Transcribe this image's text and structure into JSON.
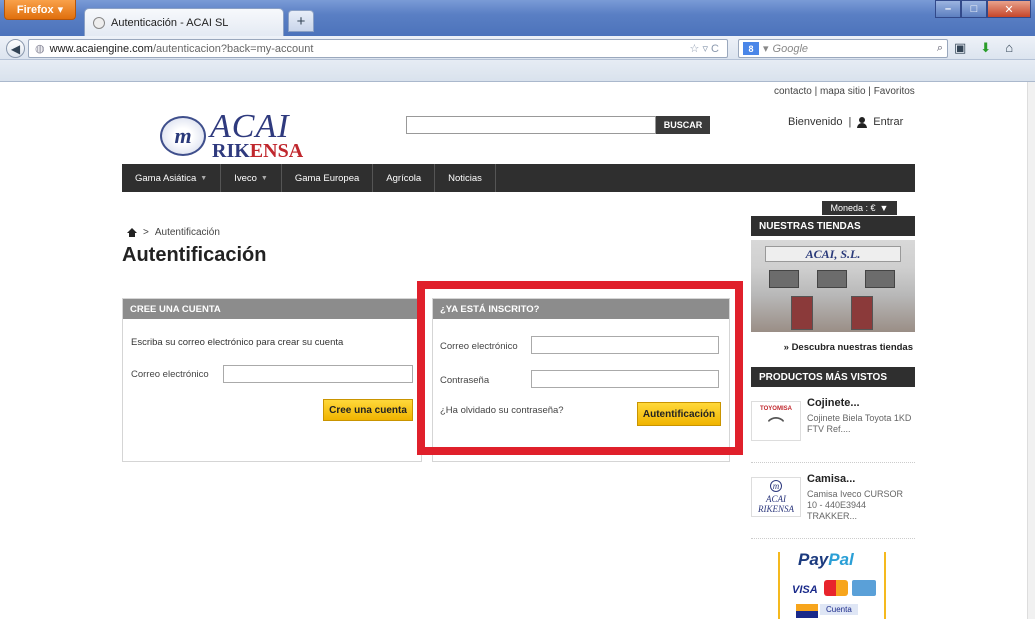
{
  "browser": {
    "app_button": "Firefox",
    "tab_title": "Autenticación - ACAI SL",
    "new_tab": "+",
    "url_host": "www.acaiengine.com",
    "url_path": "/autenticacion?back=my-account",
    "search_engine": "Google",
    "search_placeholder": "Google"
  },
  "header": {
    "toplinks": "contacto | mapa sitio | Favoritos",
    "logo_acai": "ACAI",
    "logo_rik": "RIK",
    "logo_ensa": "ENSA",
    "logo_m": "m",
    "search_button": "BUSCAR",
    "welcome": "Bienvenido",
    "login": "Entrar"
  },
  "nav": {
    "items": [
      {
        "label": "Gama Asiática",
        "dropdown": true
      },
      {
        "label": "Iveco",
        "dropdown": true
      },
      {
        "label": "Gama Europea",
        "dropdown": false
      },
      {
        "label": "Agrícola",
        "dropdown": false
      },
      {
        "label": "Noticias",
        "dropdown": false
      }
    ]
  },
  "currency": {
    "label": "Moneda : €"
  },
  "breadcrumb": {
    "sep": ">",
    "current": "Autentificación"
  },
  "page_title": "Autentificación",
  "create_account": {
    "heading": "CREE UNA CUENTA",
    "text": "Escriba su correo electrónico para crear su cuenta",
    "email_label": "Correo electrónico",
    "email_value": "",
    "button": "Cree una cuenta"
  },
  "login_form": {
    "heading": "¿YA ESTÁ INSCRITO?",
    "email_label": "Correo electrónico",
    "email_value": "",
    "password_label": "Contraseña",
    "password_value": "",
    "forgot": "¿Ha olvidado su contraseña?",
    "button": "Autentificación"
  },
  "sidebar": {
    "stores_heading": "NUESTRAS TIENDAS",
    "store_sign": "ACAI, S.L.",
    "stores_link": "» Descubra nuestras tiendas",
    "products_heading": "PRODUCTOS MÁS VISTOS",
    "products": [
      {
        "name": "Cojinete...",
        "desc": "Cojinete Biela Toyota 1KD FTV Ref....",
        "thumb_brand": "TOYOMISA"
      },
      {
        "name": "Camisa...",
        "desc": "Camisa Iveco CURSOR 10 - 440E3944 TRAKKER...",
        "thumb_brand": "ACAI RIKENSA"
      }
    ],
    "paypal": {
      "pay": "Pay",
      "pal": "Pal",
      "visa": "VISA",
      "cuenta": "Cuenta"
    }
  },
  "colors": {
    "accent_red": "#e0202b",
    "button_yellow": "#f0b400",
    "nav_dark": "#2f2f2f",
    "brand_blue": "#2f3a7e"
  }
}
